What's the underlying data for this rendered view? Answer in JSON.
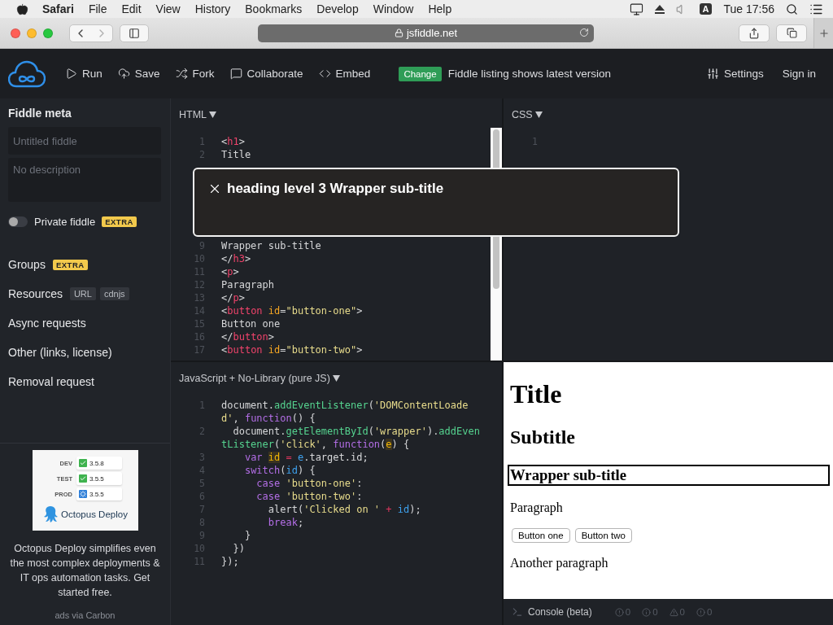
{
  "menu_bar": {
    "app": "Safari",
    "menus": [
      "File",
      "Edit",
      "View",
      "History",
      "Bookmarks",
      "Develop",
      "Window",
      "Help"
    ],
    "input_source": "A",
    "clock": "Tue 17:56"
  },
  "browser": {
    "address": "jsfiddle.net",
    "back": {
      "disabled": false
    },
    "forward": {
      "disabled": true
    }
  },
  "header": {
    "actions": [
      {
        "kind": "run",
        "label": "Run"
      },
      {
        "kind": "save",
        "label": "Save"
      },
      {
        "kind": "fork",
        "label": "Fork"
      },
      {
        "kind": "collaborate",
        "label": "Collaborate"
      },
      {
        "kind": "embed",
        "label": "Embed"
      }
    ],
    "badge": "Change",
    "notice": "Fiddle listing shows latest version",
    "settings": "Settings",
    "sign_in": "Sign in"
  },
  "sidebar": {
    "title": "Fiddle meta",
    "title_field": {
      "placeholder": "Untitled fiddle"
    },
    "description_field": {
      "placeholder": "No description"
    },
    "private_toggle": {
      "label": "Private fiddle",
      "on": false,
      "badge": "EXTRA"
    },
    "sections": [
      {
        "label": "Groups",
        "tags": [
          {
            "kind": "extra",
            "text": "EXTRA"
          }
        ]
      },
      {
        "label": "Resources",
        "tags": [
          {
            "kind": "plain",
            "text": "URL"
          },
          {
            "kind": "plain",
            "text": "cdnjs"
          }
        ]
      },
      {
        "label": "Async requests"
      },
      {
        "label": "Other (links, license)"
      },
      {
        "label": "Removal request"
      }
    ],
    "ad": {
      "rows": [
        {
          "stage": "DEV",
          "done": true,
          "version": "3.5.8"
        },
        {
          "stage": "TEST",
          "done": true,
          "version": "3.5.5"
        },
        {
          "stage": "PROD",
          "done": false,
          "version": "3.5.5"
        }
      ],
      "brand": "Octopus Deploy",
      "text": "Octopus Deploy simplifies even the most complex deployments & IT ops automation tasks. Get started free.",
      "credit": "ads via Carbon"
    }
  },
  "html_panel": {
    "label": "HTML",
    "lines": [
      {
        "number": "1",
        "tokens": [
          {
            "kind": "plain",
            "text": "<"
          },
          {
            "kind": "tag",
            "text": "h1"
          },
          {
            "kind": "plain",
            "text": ">"
          }
        ]
      },
      {
        "number": "2",
        "tokens": [
          {
            "kind": "plain",
            "text": "Title"
          }
        ]
      }
    ],
    "lines_below_popup": [
      {
        "number": "9",
        "tokens": [
          {
            "kind": "plain",
            "text": "Wrapper sub-title"
          }
        ]
      },
      {
        "number": "10",
        "tokens": [
          {
            "kind": "plain",
            "text": "</"
          },
          {
            "kind": "tag",
            "text": "h3"
          },
          {
            "kind": "plain",
            "text": ">"
          }
        ]
      },
      {
        "number": "11",
        "tokens": [
          {
            "kind": "plain",
            "text": "<"
          },
          {
            "kind": "tag",
            "text": "p"
          },
          {
            "kind": "plain",
            "text": ">"
          }
        ]
      },
      {
        "number": "12",
        "tokens": [
          {
            "kind": "plain",
            "text": "Paragraph"
          }
        ]
      },
      {
        "number": "13",
        "tokens": [
          {
            "kind": "plain",
            "text": "</"
          },
          {
            "kind": "tag",
            "text": "p"
          },
          {
            "kind": "plain",
            "text": ">"
          }
        ]
      },
      {
        "number": "14",
        "tokens": [
          {
            "kind": "plain",
            "text": "<"
          },
          {
            "kind": "tag",
            "text": "button "
          },
          {
            "kind": "attr",
            "text": "id"
          },
          {
            "kind": "plain",
            "text": "="
          },
          {
            "kind": "string",
            "text": "\"button-one\""
          },
          {
            "kind": "plain",
            "text": ">"
          }
        ]
      },
      {
        "number": "15",
        "tokens": [
          {
            "kind": "plain",
            "text": "Button one"
          }
        ]
      },
      {
        "number": "16",
        "tokens": [
          {
            "kind": "plain",
            "text": "</"
          },
          {
            "kind": "tag",
            "text": "button"
          },
          {
            "kind": "plain",
            "text": ">"
          }
        ]
      },
      {
        "number": "17",
        "tokens": [
          {
            "kind": "plain",
            "text": "<"
          },
          {
            "kind": "tag",
            "text": "button "
          },
          {
            "kind": "attr",
            "text": "id"
          },
          {
            "kind": "plain",
            "text": "="
          },
          {
            "kind": "string",
            "text": "\"button-two\""
          },
          {
            "kind": "plain",
            "text": ">"
          }
        ]
      }
    ]
  },
  "css_panel": {
    "label": "CSS",
    "lines": [
      {
        "number": "1"
      }
    ]
  },
  "popup": {
    "text": "heading level 3 Wrapper sub-title"
  },
  "js_panel": {
    "label": "JavaScript + No-Library (pure JS)",
    "lines": [
      {
        "number": "1",
        "tokens": [
          {
            "kind": "plain",
            "text": "document."
          },
          {
            "kind": "function",
            "text": "addEventListener"
          },
          {
            "kind": "plain",
            "text": "("
          },
          {
            "kind": "string",
            "text": "'DOMContentLoaded'"
          },
          {
            "kind": "plain",
            "text": ", "
          },
          {
            "kind": "keyword",
            "text": "function"
          },
          {
            "kind": "plain",
            "text": "() {"
          }
        ]
      },
      {
        "number": "2",
        "tokens": [
          {
            "kind": "plain",
            "text": "  document."
          },
          {
            "kind": "function",
            "text": "getElementById"
          },
          {
            "kind": "plain",
            "text": "("
          },
          {
            "kind": "string",
            "text": "'wrapper'"
          },
          {
            "kind": "plain",
            "text": ")."
          },
          {
            "kind": "function",
            "text": "addEventListener"
          },
          {
            "kind": "plain",
            "text": "("
          },
          {
            "kind": "string",
            "text": "'click'"
          },
          {
            "kind": "plain",
            "text": ", "
          },
          {
            "kind": "keyword",
            "text": "function"
          },
          {
            "kind": "plain",
            "text": "("
          },
          {
            "kind": "highlight",
            "text": "e"
          },
          {
            "kind": "plain",
            "text": ") {"
          }
        ]
      },
      {
        "number": "3",
        "tokens": [
          {
            "kind": "keyword",
            "text": "    var "
          },
          {
            "kind": "highlight",
            "text": "id"
          },
          {
            "kind": "operator",
            "text": " = "
          },
          {
            "kind": "variable",
            "text": "e"
          },
          {
            "kind": "plain",
            "text": ".target.id;"
          }
        ]
      },
      {
        "number": "4",
        "tokens": [
          {
            "kind": "keyword",
            "text": "    switch"
          },
          {
            "kind": "plain",
            "text": "("
          },
          {
            "kind": "variable",
            "text": "id"
          },
          {
            "kind": "plain",
            "text": ") {"
          }
        ]
      },
      {
        "number": "5",
        "tokens": [
          {
            "kind": "keyword",
            "text": "      case "
          },
          {
            "kind": "string",
            "text": "'button-one'"
          },
          {
            "kind": "plain",
            "text": ":"
          }
        ]
      },
      {
        "number": "6",
        "tokens": [
          {
            "kind": "keyword",
            "text": "      case "
          },
          {
            "kind": "string",
            "text": "'button-two'"
          },
          {
            "kind": "plain",
            "text": ":"
          }
        ]
      },
      {
        "number": "7",
        "tokens": [
          {
            "kind": "plain",
            "text": "        alert("
          },
          {
            "kind": "string",
            "text": "'Clicked on '"
          },
          {
            "kind": "operator",
            "text": " + "
          },
          {
            "kind": "variable",
            "text": "id"
          },
          {
            "kind": "plain",
            "text": ");"
          }
        ]
      },
      {
        "number": "8",
        "tokens": [
          {
            "kind": "keyword",
            "text": "        break"
          },
          {
            "kind": "plain",
            "text": ";"
          }
        ]
      },
      {
        "number": "9",
        "tokens": [
          {
            "kind": "plain",
            "text": "    }"
          }
        ]
      },
      {
        "number": "10",
        "tokens": [
          {
            "kind": "plain",
            "text": "  })"
          }
        ]
      },
      {
        "number": "11",
        "tokens": [
          {
            "kind": "plain",
            "text": "});"
          }
        ]
      }
    ]
  },
  "result": {
    "items": [
      {
        "kind": "h1",
        "text": "Title"
      },
      {
        "kind": "h2",
        "text": "Subtitle"
      },
      {
        "kind": "h3",
        "text": "Wrapper sub-title",
        "focused": true
      },
      {
        "kind": "p",
        "text": "Paragraph"
      },
      {
        "kind": "buttons",
        "buttons": [
          "Button one",
          "Button two"
        ]
      },
      {
        "kind": "p",
        "text": "Another paragraph"
      }
    ]
  },
  "console": {
    "label": "Console (beta)",
    "counters": [
      {
        "kind": "error",
        "count": "0"
      },
      {
        "kind": "info",
        "count": "0"
      },
      {
        "kind": "warning",
        "count": "0"
      },
      {
        "kind": "log",
        "count": "0"
      }
    ]
  }
}
